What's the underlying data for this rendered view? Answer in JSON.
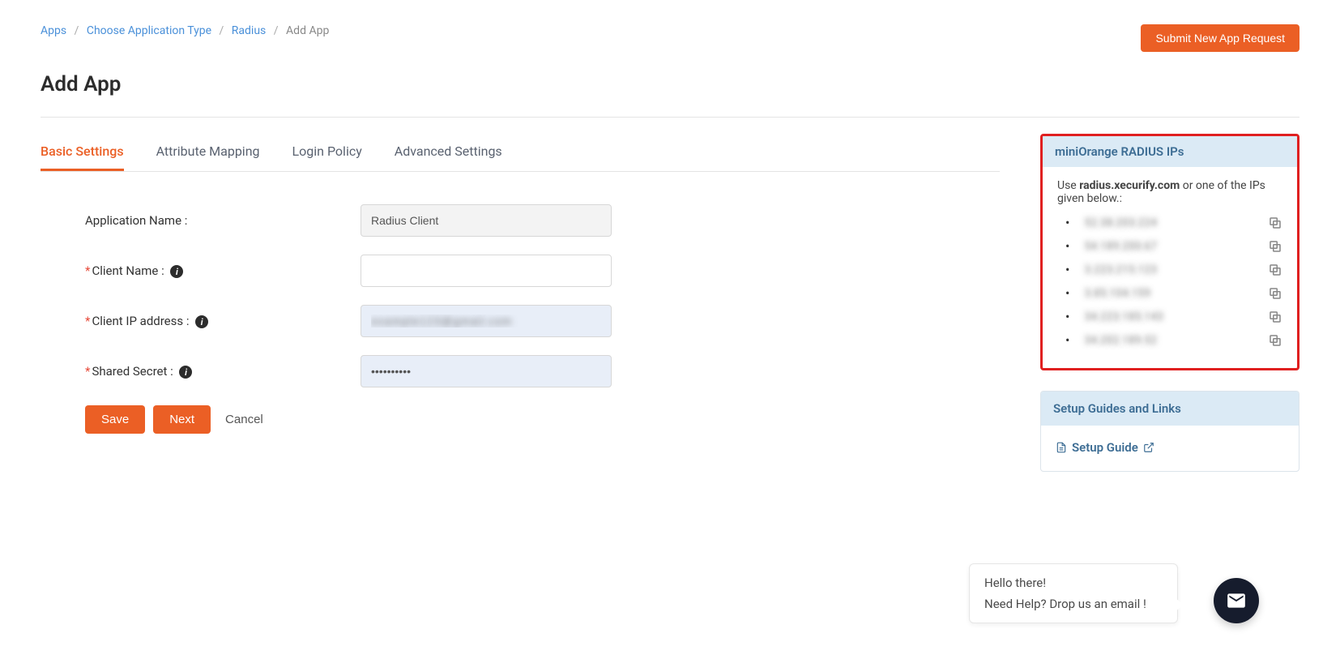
{
  "breadcrumb": {
    "items": [
      "Apps",
      "Choose Application Type",
      "Radius"
    ],
    "current": "Add App"
  },
  "header": {
    "submit_button": "Submit New App Request",
    "page_title": "Add App"
  },
  "tabs": [
    {
      "label": "Basic Settings",
      "active": true
    },
    {
      "label": "Attribute Mapping",
      "active": false
    },
    {
      "label": "Login Policy",
      "active": false
    },
    {
      "label": "Advanced Settings",
      "active": false
    }
  ],
  "form": {
    "app_name_label": "Application Name :",
    "app_name_value": "Radius Client",
    "client_name_label": "Client Name :",
    "client_name_value": "",
    "client_ip_label": "Client IP address :",
    "client_ip_value": "example123@gmail.com",
    "shared_secret_label": "Shared Secret :",
    "shared_secret_value": "••••••••••",
    "save_label": "Save",
    "next_label": "Next",
    "cancel_label": "Cancel"
  },
  "radius_panel": {
    "title": "miniOrange RADIUS IPs",
    "use_prefix": "Use ",
    "use_domain": "radius.xecurify.com",
    "use_suffix": " or one of the IPs given below.:",
    "ips": [
      "52.38.203.224",
      "54.189.200.67",
      "3.223.215.123",
      "3.85.104.159",
      "34.223.185.143",
      "34.202.189.52"
    ]
  },
  "guides_panel": {
    "title": "Setup Guides and Links",
    "link_label": "Setup Guide"
  },
  "chat": {
    "greeting": "Hello there!",
    "help_text": "Need Help? Drop us an email !"
  }
}
